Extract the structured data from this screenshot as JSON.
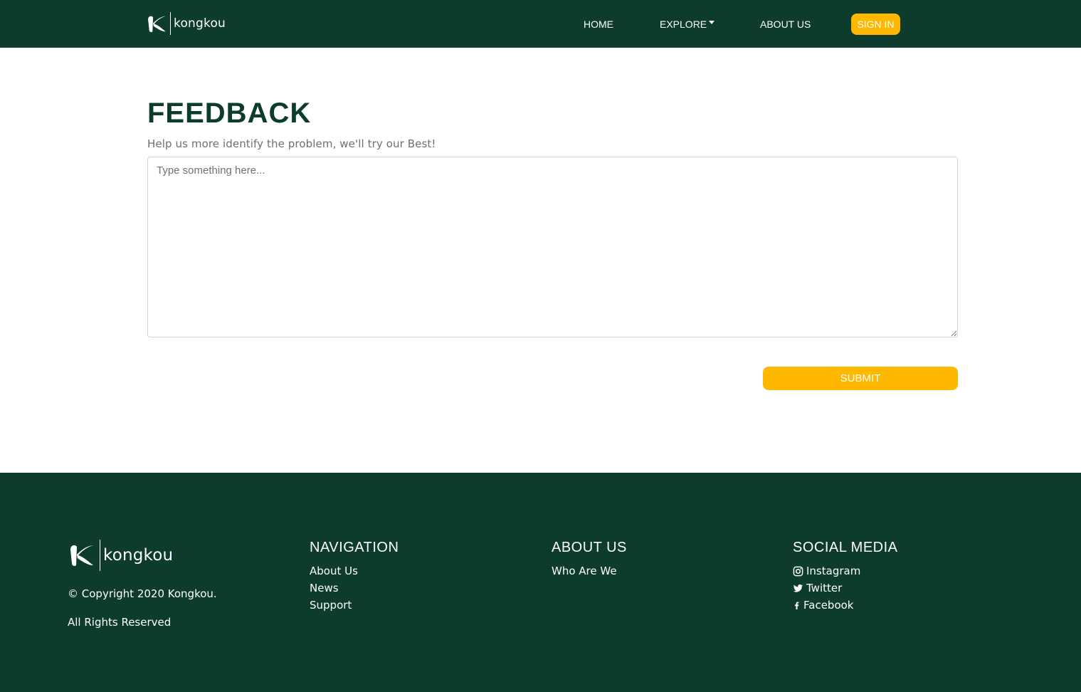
{
  "header": {
    "logo_text": "kongkou",
    "nav": {
      "home": "HOME",
      "explore": "EXPLORE",
      "about": "ABOUT US"
    },
    "signin_label": "SIGN IN"
  },
  "main": {
    "title": "FEEDBACK",
    "subtitle": "Help us more identify the problem, we'll try our Best!",
    "textarea_placeholder": "Type something here...",
    "submit_label": "SUBMIT"
  },
  "footer": {
    "logo_text": "kongkou",
    "copyright": "© Copyright 2020 Kongkou.",
    "rights": "All Rights Reserved",
    "navigation": {
      "heading": "NAVIGATION",
      "links": [
        "About Us",
        "News",
        "Support"
      ]
    },
    "about": {
      "heading": "ABOUT US",
      "links": [
        "Who Are We"
      ]
    },
    "social": {
      "heading": "SOCIAL MEDIA",
      "links": [
        {
          "label": "Instagram",
          "icon": "instagram-icon"
        },
        {
          "label": "Twitter",
          "icon": "twitter-icon"
        },
        {
          "label": "Facebook",
          "icon": "facebook-icon"
        }
      ]
    }
  },
  "colors": {
    "brand_green": "#0d3b2e",
    "accent_yellow": "#ffb800"
  }
}
